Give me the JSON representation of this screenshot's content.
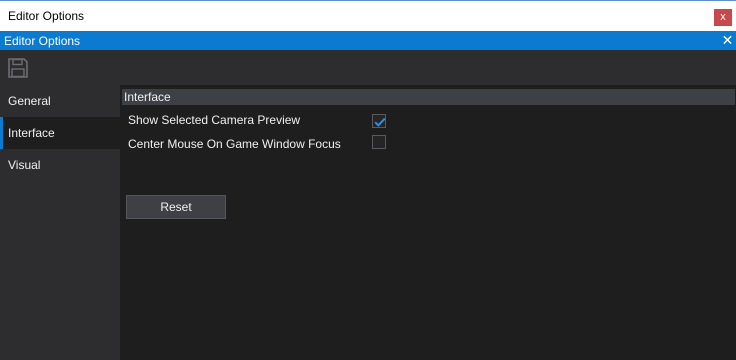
{
  "window": {
    "title": "Editor Options",
    "close_label": "x"
  },
  "panel": {
    "title": "Editor Options",
    "close_label": "✕"
  },
  "toolbar": {
    "save_icon": "save-icon"
  },
  "sidebar": {
    "items": [
      {
        "label": "General",
        "active": false
      },
      {
        "label": "Interface",
        "active": true
      },
      {
        "label": "Visual",
        "active": false
      }
    ]
  },
  "content": {
    "group_title": "Interface",
    "options": [
      {
        "label": "Show Selected Camera Preview",
        "checked": true
      },
      {
        "label": "Center Mouse On Game Window Focus",
        "checked": false
      }
    ],
    "reset_label": "Reset"
  },
  "colors": {
    "accent": "#0b7ad1",
    "close_button": "#c8494c",
    "panel_bg": "#2d2d30",
    "content_bg": "#1e1e1e"
  }
}
